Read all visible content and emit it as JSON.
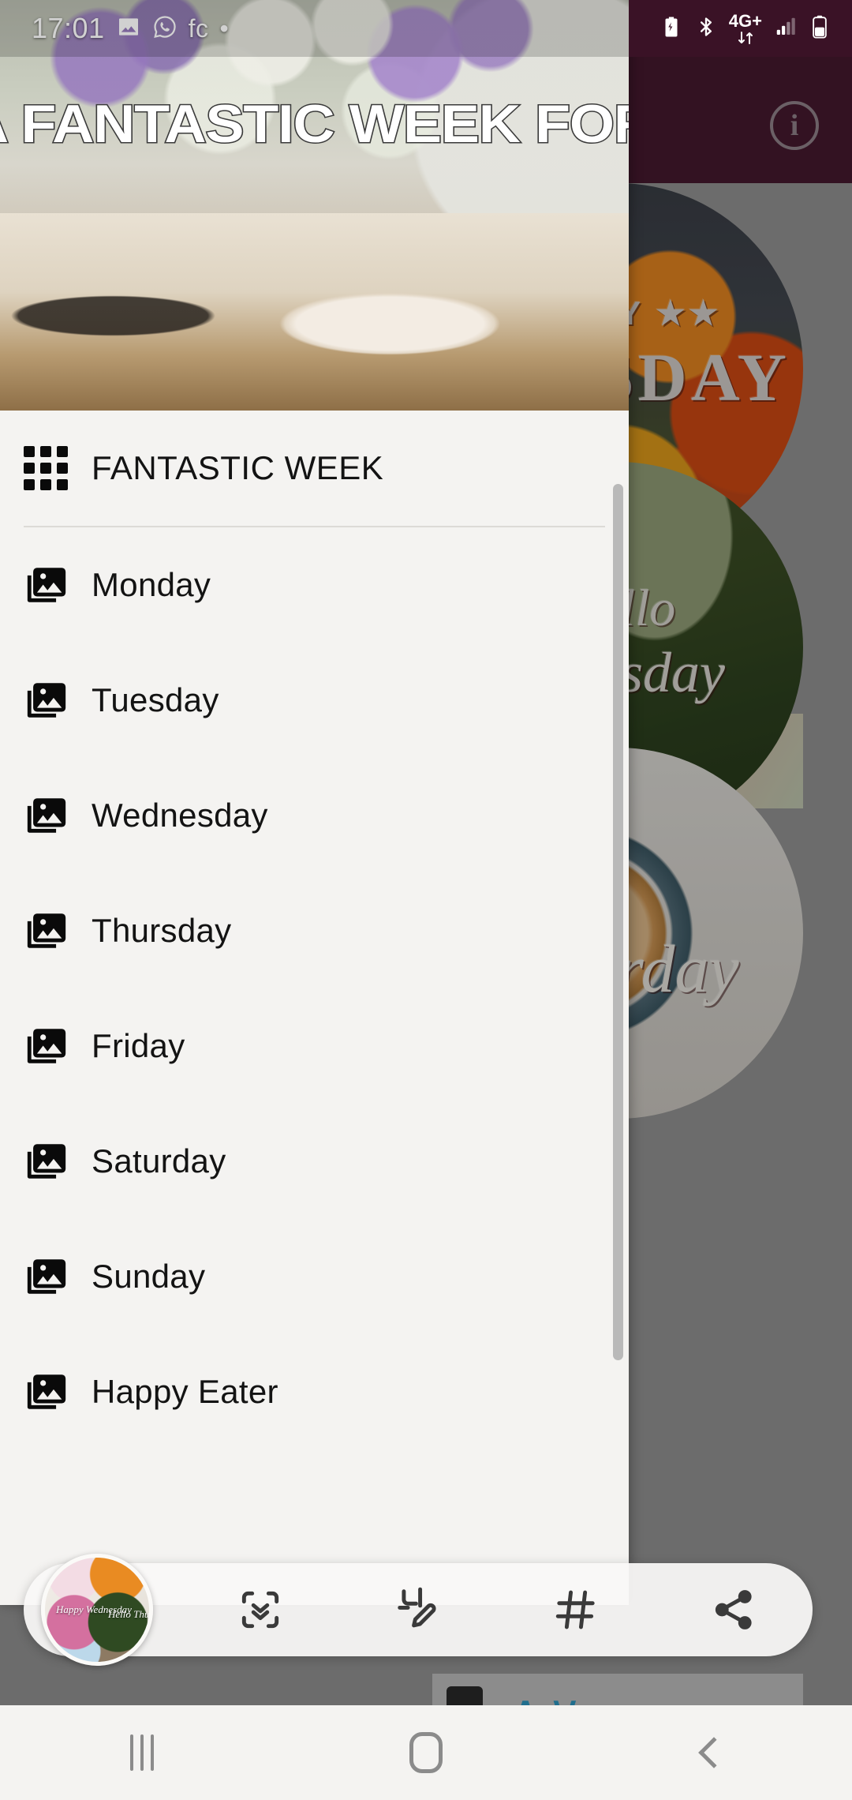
{
  "status_bar": {
    "time": "17:01",
    "left_icons": [
      "image-icon",
      "whatsapp-icon"
    ],
    "left_text": "fc",
    "dot": "•",
    "right_icons": [
      "battery-saver-icon",
      "bluetooth-icon",
      "network-4gplus-icon",
      "signal-bars-icon",
      "battery-icon"
    ],
    "network_label": "4G+"
  },
  "background_app": {
    "appbar_color": "#4a1a32",
    "info_icon": "info-icon",
    "info_glyph": "i",
    "thumbnails": [
      {
        "caption_line1": "HAPPY ★★",
        "caption_line2": "TUESDAY",
        "name": "thumb-happy-tuesday"
      },
      {
        "caption_line1": "Hello",
        "caption_line2": "Thursday",
        "name": "thumb-hello-thursday"
      },
      {
        "caption_line1": "Saturday",
        "caption_line2": "",
        "name": "thumb-saturday"
      }
    ],
    "bottom_card_label": "∧∨"
  },
  "drawer": {
    "header": {
      "banner_text": "A FANTASTIC WEEK FOR YOU",
      "image_alt": "book-glasses-coffee-flowers-photo"
    },
    "section_title": {
      "label": "FANTASTIC WEEK",
      "icon": "grid-icon"
    },
    "items": [
      {
        "label": "Monday",
        "icon": "photo-library-icon"
      },
      {
        "label": "Tuesday",
        "icon": "photo-library-icon"
      },
      {
        "label": "Wednesday",
        "icon": "photo-library-icon"
      },
      {
        "label": "Thursday",
        "icon": "photo-library-icon"
      },
      {
        "label": "Friday",
        "icon": "photo-library-icon"
      },
      {
        "label": "Saturday",
        "icon": "photo-library-icon"
      },
      {
        "label": "Sunday",
        "icon": "photo-library-icon"
      },
      {
        "label": "Happy Eater",
        "icon": "photo-library-icon"
      }
    ],
    "scrollbar": {
      "visible": true
    }
  },
  "toolbar": {
    "avatar": {
      "name": "album-collage-avatar",
      "captions": [
        "Happy Wednesday",
        "Hello Thursday"
      ]
    },
    "actions": [
      {
        "name": "scan-extract-button",
        "icon": "scan-chevrons-icon"
      },
      {
        "name": "edit-crop-button",
        "icon": "crop-pencil-icon"
      },
      {
        "name": "hashtag-button",
        "icon": "hashtag-icon",
        "glyph": "#"
      },
      {
        "name": "share-button",
        "icon": "share-icon"
      }
    ]
  },
  "nav_bar": {
    "recents": "recents-icon",
    "home": "home-icon",
    "back": "back-icon"
  },
  "colors": {
    "appbar": "#4a1a32",
    "drawer_bg": "#f4f3f1",
    "text": "#131313",
    "scrim": "rgba(0,0,0,0.30)",
    "scrollbar": "#b9b9b9"
  }
}
